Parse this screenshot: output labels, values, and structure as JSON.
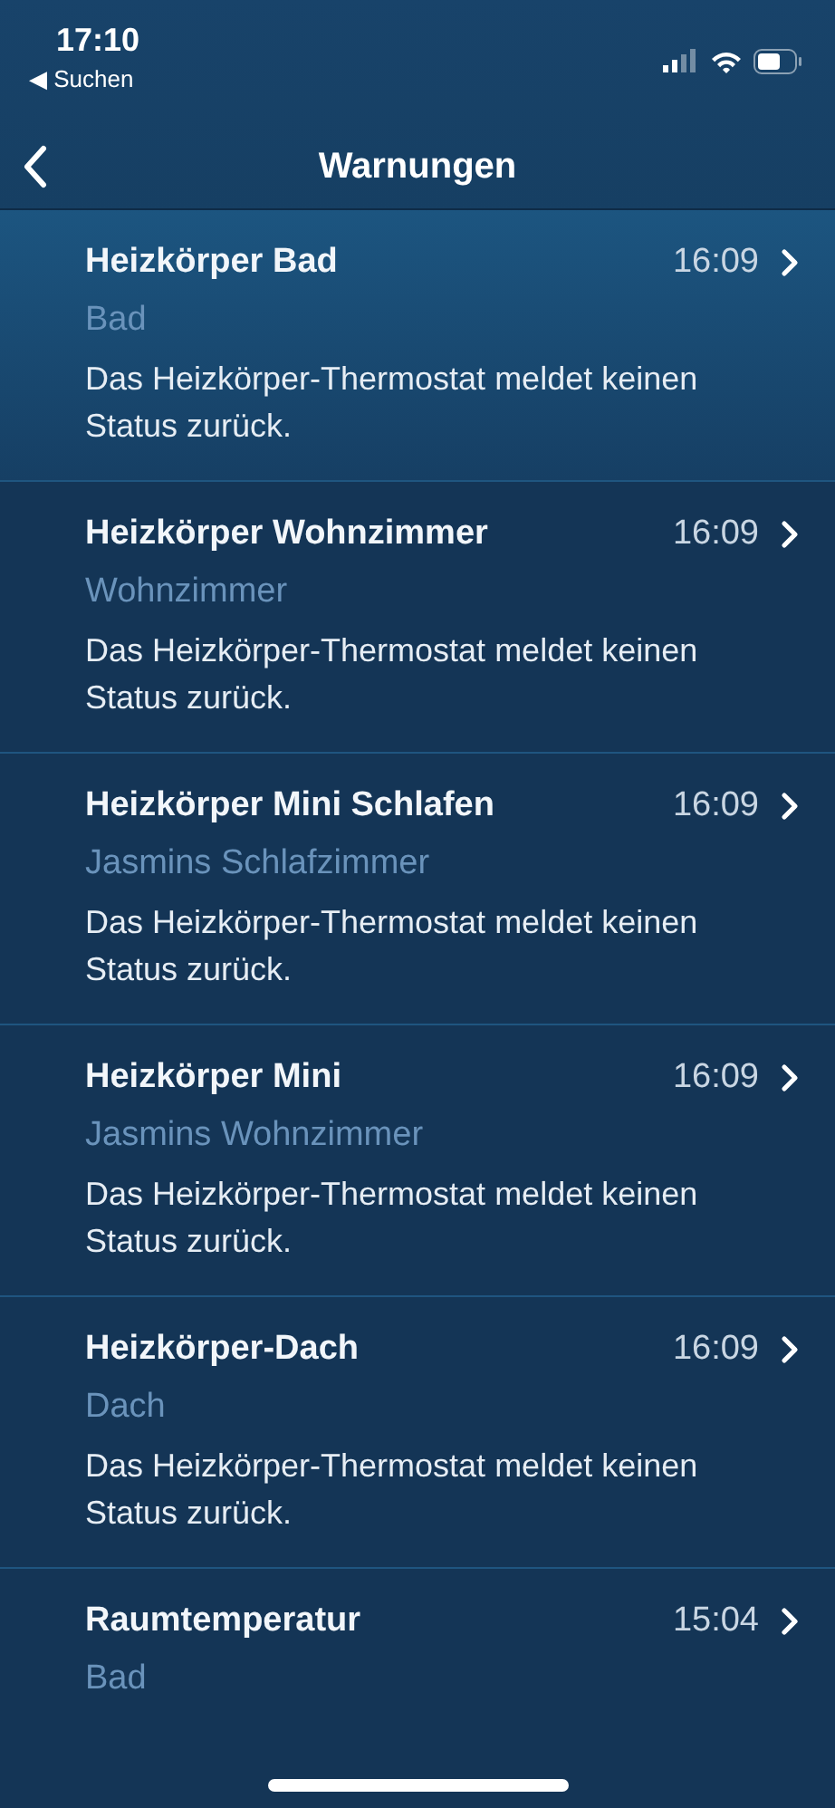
{
  "status_bar": {
    "time": "17:10",
    "back_app": "◀ Suchen"
  },
  "nav": {
    "title": "Warnungen"
  },
  "warnings": [
    {
      "title": "Heizkörper Bad",
      "time": "16:09",
      "location": "Bad",
      "message": "Das Heizkörper-Thermostat meldet keinen Status zurück.",
      "selected": true
    },
    {
      "title": "Heizkörper Wohnzimmer",
      "time": "16:09",
      "location": "Wohnzimmer",
      "message": "Das Heizkörper-Thermostat meldet keinen Status zurück.",
      "selected": false
    },
    {
      "title": "Heizkörper Mini Schlafen",
      "time": "16:09",
      "location": "Jasmins Schlafzimmer",
      "message": "Das Heizkörper-Thermostat meldet keinen Status zurück.",
      "selected": false
    },
    {
      "title": "Heizkörper Mini",
      "time": "16:09",
      "location": "Jasmins Wohnzimmer",
      "message": "Das Heizkörper-Thermostat meldet keinen Status zurück.",
      "selected": false
    },
    {
      "title": "Heizkörper-Dach",
      "time": "16:09",
      "location": "Dach",
      "message": "Das Heizkörper-Thermostat meldet keinen Status zurück.",
      "selected": false
    },
    {
      "title": "Raumtemperatur",
      "time": "15:04",
      "location": "Bad",
      "selected": false
    }
  ]
}
